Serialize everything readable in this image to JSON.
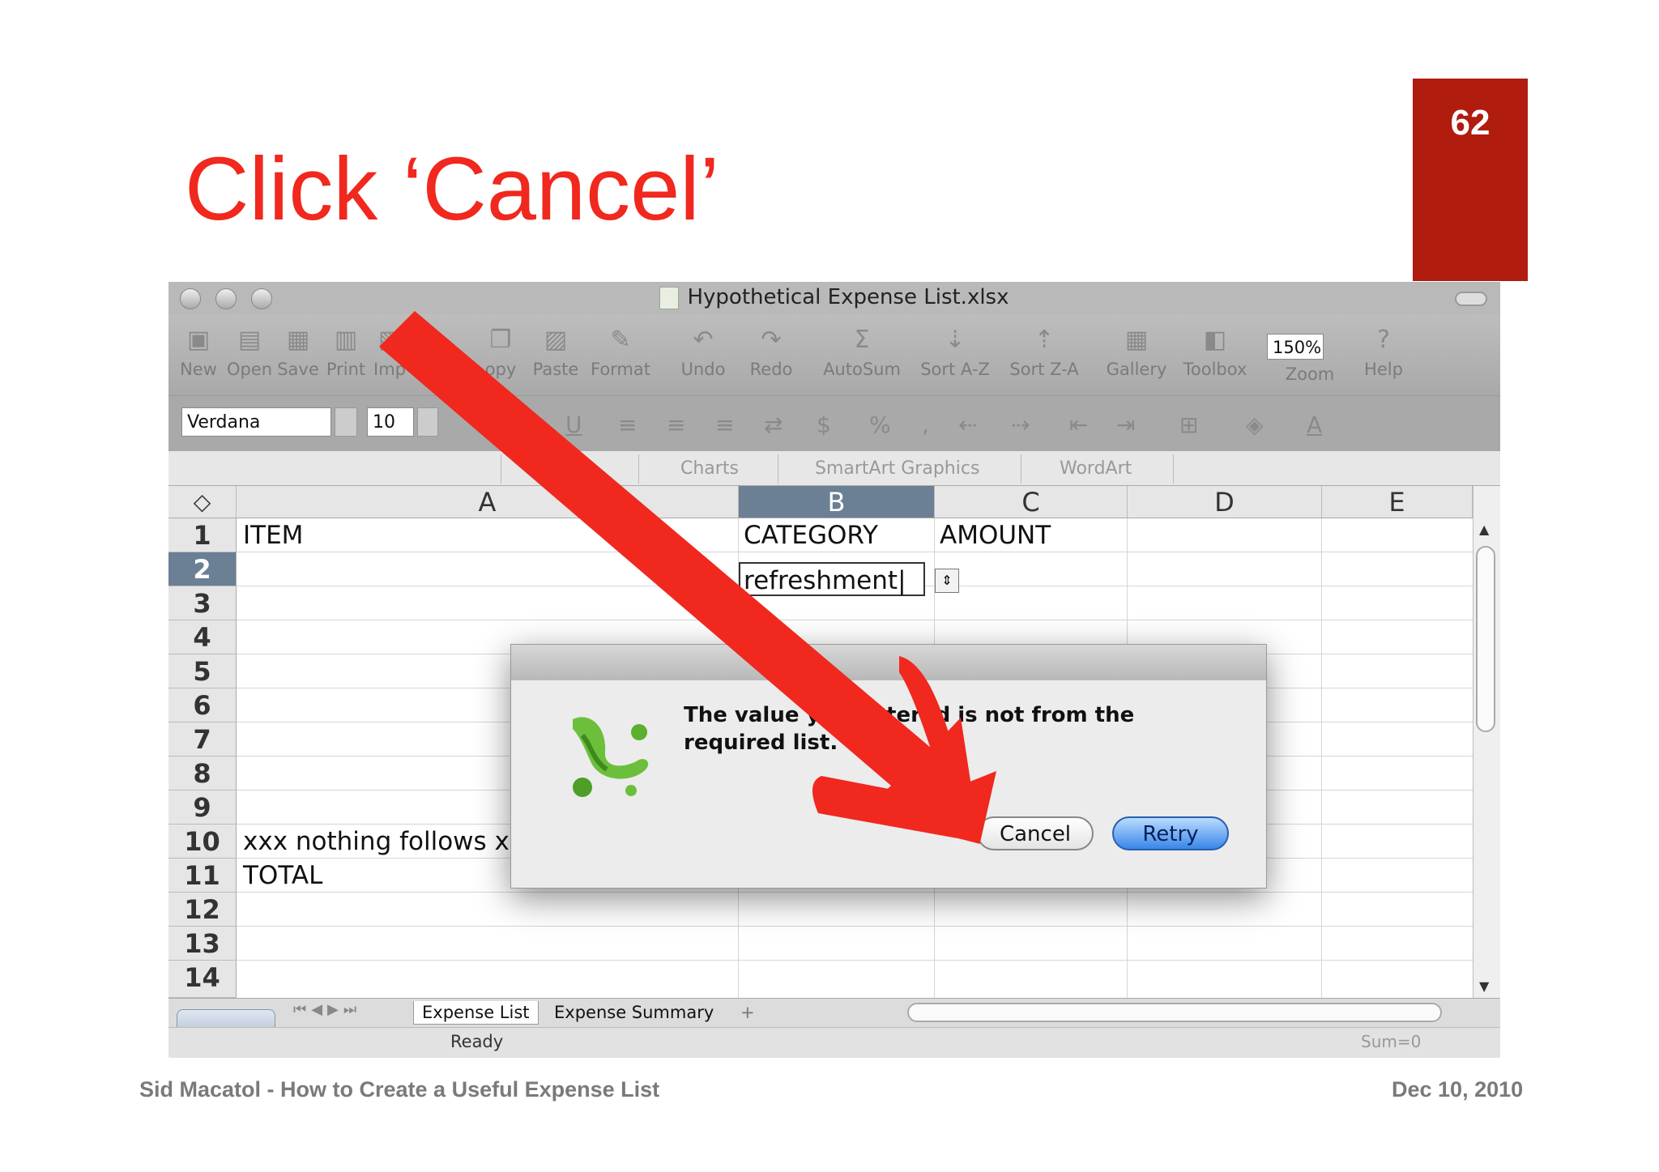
{
  "slide": {
    "number": "62",
    "title": "Click ‘Cancel’",
    "footer_left": "Sid Macatol - How to Create a Useful Expense List",
    "footer_right": "Dec 10, 2010",
    "accent_color": "#f0281e",
    "badge_color": "#b01c0e"
  },
  "window": {
    "title": "Hypothetical Expense List.xlsx"
  },
  "toolbar": {
    "items": [
      "New",
      "Open",
      "Save",
      "Print",
      "Imp",
      "opy",
      "Paste",
      "Format",
      "Undo",
      "Redo",
      "AutoSum",
      "Sort A-Z",
      "Sort Z-A",
      "Gallery",
      "Toolbox",
      "Zoom",
      "Help"
    ],
    "zoom_value": "150%"
  },
  "formatbar": {
    "font": "Verdana",
    "size": "10"
  },
  "ribbon": {
    "tabs": [
      "Charts",
      "SmartArt Graphics",
      "WordArt"
    ]
  },
  "sheet": {
    "columns": [
      "A",
      "B",
      "C",
      "D",
      "E"
    ],
    "rows": [
      "1",
      "2",
      "3",
      "4",
      "5",
      "6",
      "7",
      "8",
      "9",
      "10",
      "11",
      "12",
      "13",
      "14"
    ],
    "cells": {
      "a1": "ITEM",
      "b1": "CATEGORY",
      "c1": "AMOUNT",
      "b2": "refreshment",
      "a10": "xxx nothing follows x",
      "a11": "TOTAL"
    },
    "tabs": [
      "Expense List",
      "Expense Summary"
    ],
    "status": "Ready",
    "sum": "Sum=0"
  },
  "dialog": {
    "message": "The value you entered is not from the required list.",
    "cancel_label": "Cancel",
    "retry_label": "Retry"
  }
}
